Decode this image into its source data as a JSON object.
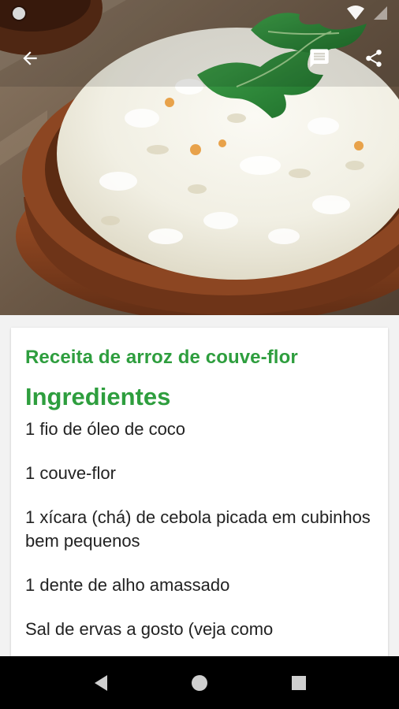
{
  "hero": {
    "image_icon": "cauliflower-rice-bowl-photo"
  },
  "status_bar": {
    "icons": [
      "notification-dot-icon",
      "wifi-icon",
      "signal-icon"
    ]
  },
  "app_bar": {
    "back_icon": "arrow-back-icon",
    "comments_icon": "comment-icon",
    "share_icon": "share-icon"
  },
  "recipe": {
    "title": "Receita de arroz de couve-flor",
    "ingredients_heading": "Ingredientes",
    "ingredients": [
      "1 fio de óleo de coco",
      "1 couve-flor",
      "1 xícara (chá) de cebola picada em cubinhos bem pequenos",
      "1 dente de alho amassado",
      "Sal de ervas a gosto (veja como"
    ]
  },
  "nav_bar": {
    "icons": [
      "nav-back-icon",
      "nav-home-icon",
      "nav-recents-icon"
    ]
  },
  "colors": {
    "accent_green": "#2e9e3e",
    "text": "#222222",
    "card_bg": "#ffffff",
    "page_bg": "#f2f2f2",
    "nav_bg": "#000000"
  }
}
